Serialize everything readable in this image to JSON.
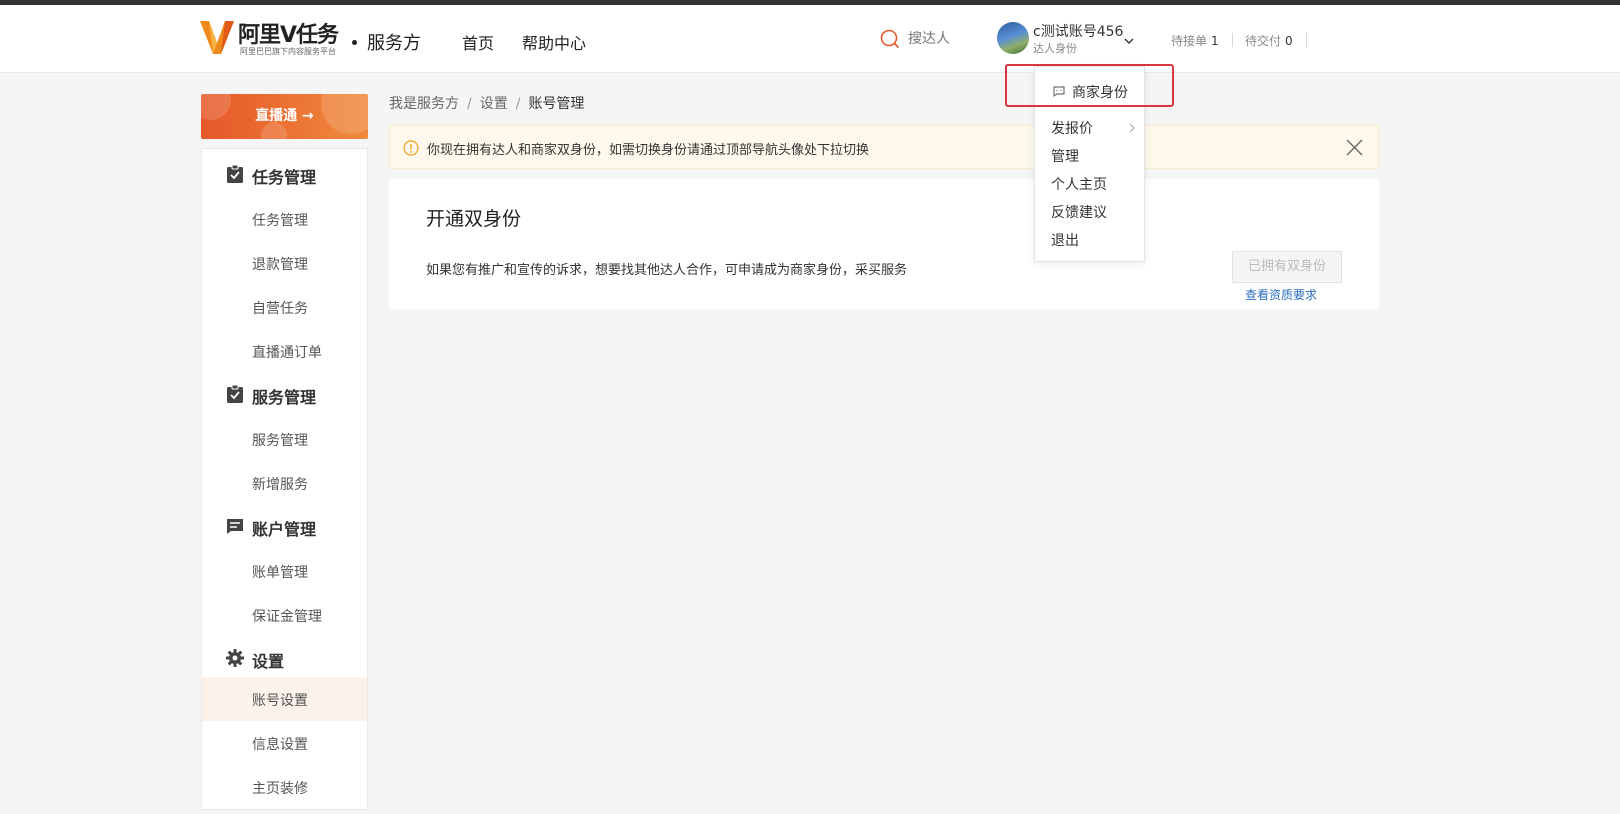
{
  "header": {
    "logo_text": "阿里V任务",
    "logo_subtitle": "阿里巴巴旗下内容服务平台",
    "role_label": "服务方",
    "nav": {
      "home": "首页",
      "help": "帮助中心"
    },
    "search": {
      "placeholder": "搜达人"
    },
    "user": {
      "name": "c测试账号456",
      "role": "达人身份"
    },
    "stats": [
      {
        "label": "待接单",
        "value": "1"
      },
      {
        "label": "待交付",
        "value": "0"
      }
    ]
  },
  "sidebar": {
    "banner": "直播通 →",
    "groups": [
      {
        "title": "任务管理",
        "icon": "task-check-icon",
        "items": [
          "任务管理",
          "退款管理",
          "自营任务",
          "直播通订单"
        ]
      },
      {
        "title": "服务管理",
        "icon": "service-check-icon",
        "items": [
          "服务管理",
          "新增服务"
        ]
      },
      {
        "title": "账户管理",
        "icon": "account-list-icon",
        "items": [
          "账单管理",
          "保证金管理"
        ]
      },
      {
        "title": "设置",
        "icon": "gear-icon",
        "items": [
          "账号设置",
          "信息设置",
          "主页装修"
        ]
      }
    ],
    "active_item": "账号设置"
  },
  "breadcrumb": [
    "我是服务方",
    "设置",
    "账号管理"
  ],
  "alert": {
    "text": "你现在拥有达人和商家双身份，如需切换身份请通过顶部导航头像处下拉切换"
  },
  "card": {
    "title": "开通双身份",
    "description": "如果您有推广和宣传的诉求，想要找其他达人合作，可申请成为商家身份，采买服务",
    "button": "已拥有双身份",
    "link": "查看资质要求"
  },
  "dropdown": {
    "items": [
      "商家身份",
      "发报价",
      "管理",
      "个人主页",
      "反馈建议",
      "退出"
    ]
  },
  "colors": {
    "accent_orange": "#e6582a",
    "highlight_red": "#d9363e",
    "link_blue": "#2c6ebf"
  }
}
